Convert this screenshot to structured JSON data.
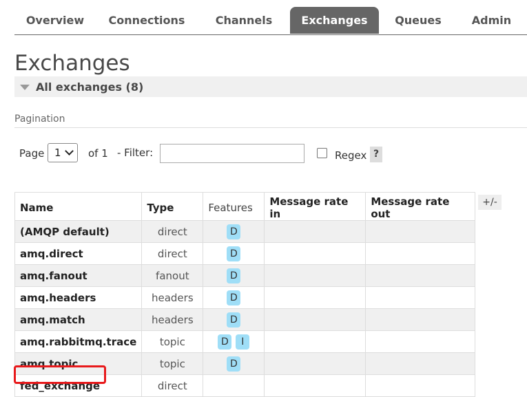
{
  "tabs": [
    "Overview",
    "Connections",
    "Channels",
    "Exchanges",
    "Queues",
    "Admin"
  ],
  "active_tab": "Exchanges",
  "title": "Exchanges",
  "section_label": "All exchanges (8)",
  "pagination": {
    "label": "Pagination",
    "page_label": "Page",
    "page_value": "1",
    "of_label": "of 1",
    "filter_label": "- Filter:",
    "filter_value": "",
    "regex_label": "Regex",
    "regex_checked": false,
    "help_label": "?"
  },
  "table": {
    "columns": [
      "Name",
      "Type",
      "Features",
      "Message rate in",
      "Message rate out"
    ],
    "toggle_label": "+/-",
    "rows": [
      {
        "name": "(AMQP default)",
        "type": "direct",
        "features": [
          "D"
        ]
      },
      {
        "name": "amq.direct",
        "type": "direct",
        "features": [
          "D"
        ]
      },
      {
        "name": "amq.fanout",
        "type": "fanout",
        "features": [
          "D"
        ]
      },
      {
        "name": "amq.headers",
        "type": "headers",
        "features": [
          "D"
        ]
      },
      {
        "name": "amq.match",
        "type": "headers",
        "features": [
          "D"
        ]
      },
      {
        "name": "amq.rabbitmq.trace",
        "type": "topic",
        "features": [
          "D",
          "I"
        ]
      },
      {
        "name": "amq.topic",
        "type": "topic",
        "features": [
          "D"
        ]
      },
      {
        "name": "fed_exchange",
        "type": "direct",
        "features": []
      }
    ]
  },
  "colors": {
    "active_tab_bg": "#666666",
    "badge": "#9fdef7",
    "highlight": "#e8191b"
  }
}
